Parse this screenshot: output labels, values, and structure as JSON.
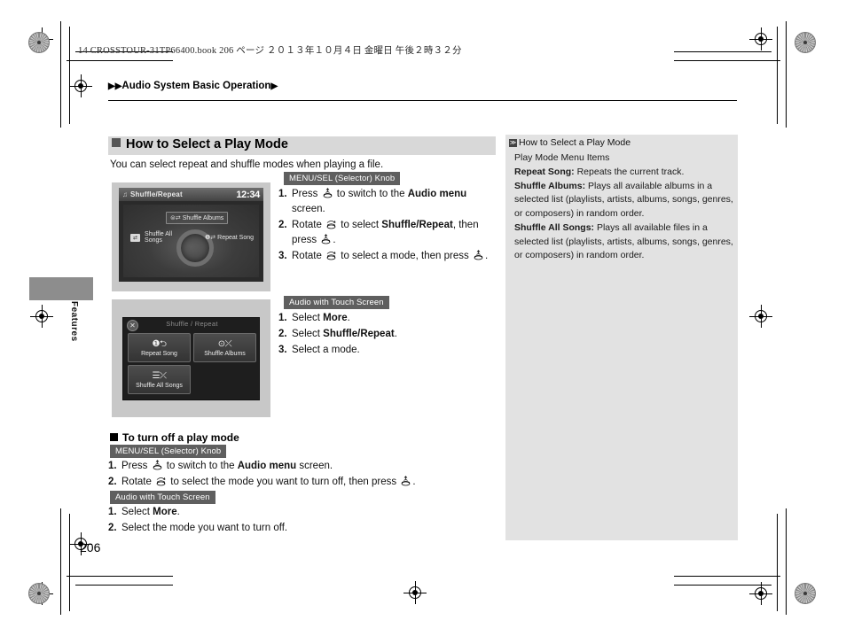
{
  "print_marks": {
    "book_line": "14 CROSSTOUR-31TP66400.book   206 ページ   ２０１３年１０月４日   金曜日   午後２時３２分"
  },
  "breadcrumb": {
    "left_arrows": "▶▶",
    "text": "Audio System Basic Operation",
    "right_arrow": "▶"
  },
  "margin_tab": {
    "label": "Features"
  },
  "heading": {
    "title": "How to Select a Play Mode",
    "intro": "You can select repeat and shuffle modes when playing a file."
  },
  "screen_knob": {
    "title": "Shuffle/Repeat",
    "note_icon": "♫",
    "time": "12:34",
    "options": [
      {
        "icon": "⊜⇄",
        "label": "Shuffle  Albums"
      },
      {
        "icon": "⇄",
        "label": "Shuffle All Songs"
      },
      {
        "icon": "❶⇄",
        "label": "Repeat Song"
      }
    ]
  },
  "screen_touch": {
    "title": "Shuffle / Repeat",
    "close_icon": "✕",
    "tiles": [
      {
        "icon": "❶⮌",
        "label": "Repeat Song"
      },
      {
        "icon": "⊙⤫",
        "label": "Shuffle Albums"
      },
      {
        "icon": "☰⤫",
        "label": "Shuffle All Songs"
      }
    ]
  },
  "instructions": {
    "knob_badge": "MENU/SEL (Selector) Knob",
    "touch_badge": "Audio with Touch Screen",
    "knob_steps": [
      {
        "n": "1.",
        "parts": [
          {
            "t": "Press "
          },
          {
            "icon": "press-knob"
          },
          {
            "t": " to switch to the "
          },
          {
            "b": "Audio menu"
          },
          {
            "t": " screen."
          }
        ]
      },
      {
        "n": "2.",
        "parts": [
          {
            "t": "Rotate "
          },
          {
            "icon": "rotate-knob"
          },
          {
            "t": " to select "
          },
          {
            "b": "Shuffle/Repeat"
          },
          {
            "t": ", then press "
          },
          {
            "icon": "press-knob"
          },
          {
            "t": "."
          }
        ]
      },
      {
        "n": "3.",
        "parts": [
          {
            "t": "Rotate "
          },
          {
            "icon": "rotate-knob"
          },
          {
            "t": " to select a mode, then press "
          },
          {
            "icon": "press-knob"
          },
          {
            "t": "."
          }
        ]
      }
    ],
    "touch_steps": [
      {
        "n": "1.",
        "parts": [
          {
            "t": "Select "
          },
          {
            "b": "More"
          },
          {
            "t": "."
          }
        ]
      },
      {
        "n": "2.",
        "parts": [
          {
            "t": "Select "
          },
          {
            "b": "Shuffle/Repeat"
          },
          {
            "t": "."
          }
        ]
      },
      {
        "n": "3.",
        "parts": [
          {
            "t": "Select a mode."
          }
        ]
      }
    ]
  },
  "turn_off": {
    "title": "To turn off a play mode",
    "knob_badge": "MENU/SEL (Selector) Knob",
    "touch_badge": "Audio with Touch Screen",
    "knob_steps": [
      {
        "n": "1.",
        "parts": [
          {
            "t": "Press "
          },
          {
            "icon": "press-knob"
          },
          {
            "t": " to switch to the "
          },
          {
            "b": "Audio menu"
          },
          {
            "t": " screen."
          }
        ]
      },
      {
        "n": "2.",
        "parts": [
          {
            "t": "Rotate "
          },
          {
            "icon": "rotate-knob"
          },
          {
            "t": " to select the mode you want to turn off, then press "
          },
          {
            "icon": "press-knob"
          },
          {
            "t": "."
          }
        ]
      }
    ],
    "touch_steps": [
      {
        "n": "1.",
        "parts": [
          {
            "t": "Select "
          },
          {
            "b": "More"
          },
          {
            "t": "."
          }
        ]
      },
      {
        "n": "2.",
        "parts": [
          {
            "t": "Select the mode you want to turn off."
          }
        ]
      }
    ]
  },
  "sidebar": {
    "mark": "≫",
    "head": "How to Select a Play Mode",
    "subhead": "Play Mode Menu Items",
    "entries": [
      {
        "term": "Repeat Song:",
        "desc": " Repeats the current track."
      },
      {
        "term": "Shuffle Albums:",
        "desc": " Plays all available albums in a selected list (playlists, artists, albums, songs, genres, or composers) in random order."
      },
      {
        "term": "Shuffle All Songs:",
        "desc": " Plays all available files in a selected list (playlists, artists, albums, songs, genres, or composers) in random order."
      }
    ]
  },
  "page_number": "206",
  "colors": {
    "heading_band": "#d8d8d8",
    "sidebar_bg": "#e2e2e2",
    "badge_bg": "#5f5f5f",
    "tab_bg": "#8d8d8d"
  }
}
